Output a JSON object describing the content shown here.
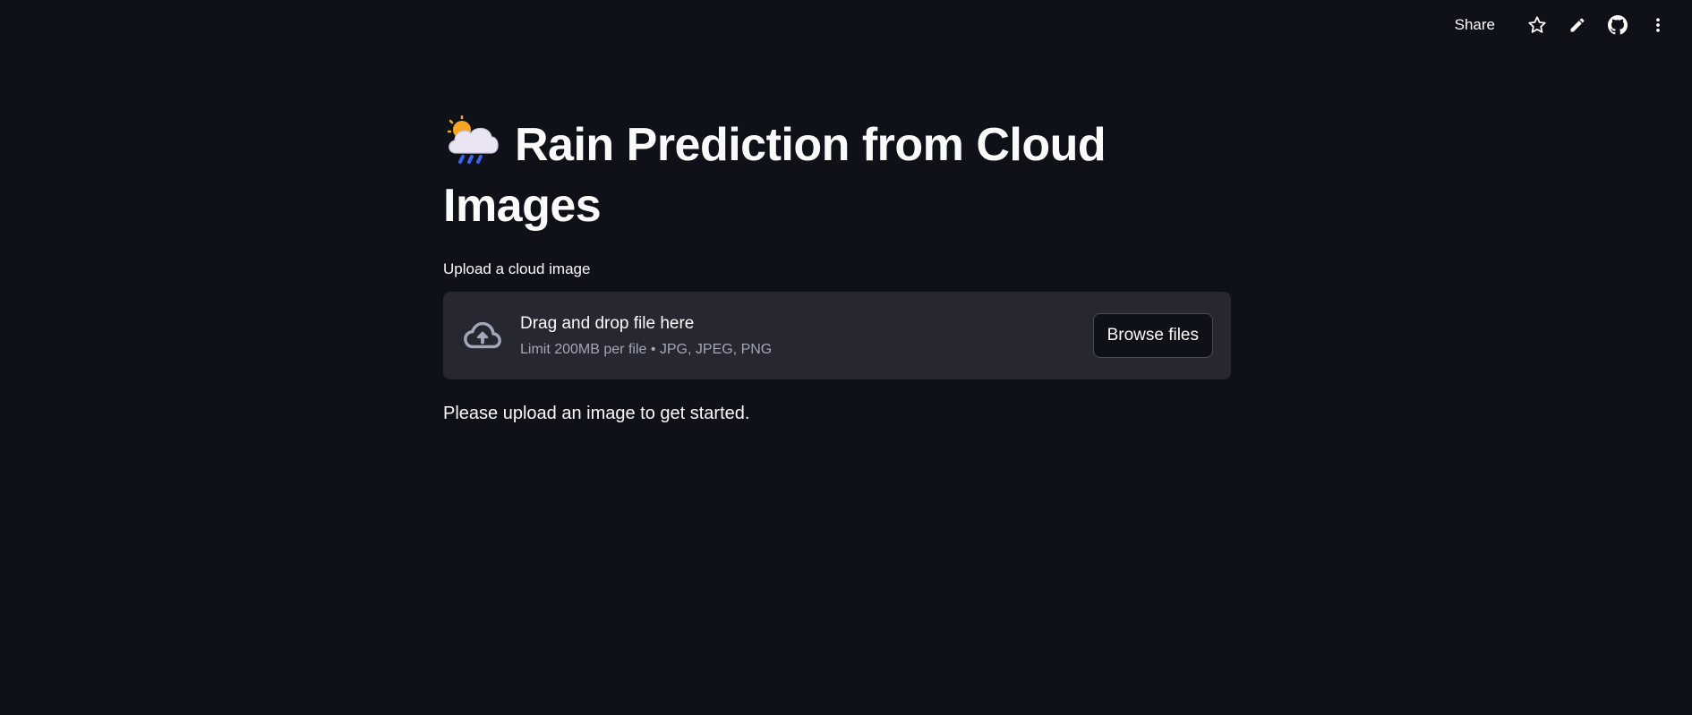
{
  "toolbar": {
    "share_label": "Share",
    "icons": [
      "star-icon",
      "pencil-icon",
      "github-icon",
      "more-vertical-icon"
    ]
  },
  "main": {
    "title_emoji": "cloud-with-rain-emoji",
    "title": "Rain Prediction from Cloud Images",
    "uploader": {
      "label": "Upload a cloud image",
      "drop_title": "Drag and drop file here",
      "limit_text": "Limit 200MB per file • JPG, JPEG, PNG",
      "browse_label": "Browse files",
      "icon": "cloud-upload-icon"
    },
    "info_text": "Please upload an image to get started."
  },
  "colors": {
    "background": "#0e1117",
    "dropzone_bg": "#262730",
    "text": "#fafafa",
    "muted_text": "#a3a8b8",
    "button_border": "#4a4c57"
  }
}
